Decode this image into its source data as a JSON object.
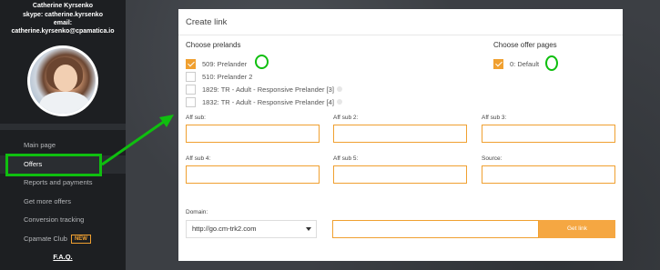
{
  "user": {
    "name": "Catherine Kyrsenko",
    "skype": "skype: catherine.kyrsenko",
    "email_label": "email:",
    "email": "catherine.kyrsenko@cpamatica.io"
  },
  "sidebar": {
    "items": [
      {
        "label": "Main page"
      },
      {
        "label": "Offers"
      },
      {
        "label": "Reports and payments"
      },
      {
        "label": "Get more offers"
      },
      {
        "label": "Conversion tracking"
      },
      {
        "label": "Cpamate Club",
        "badge": "NEW"
      }
    ],
    "faq": "F.A.Q."
  },
  "panel": {
    "title": "Create link",
    "prelands_title": "Choose prelands",
    "prelands": [
      {
        "label": "509: Prelander",
        "checked": true
      },
      {
        "label": "510: Prelander 2",
        "checked": false
      },
      {
        "label": "1829: TR - Adult - Responsive Prelander [3]",
        "checked": false
      },
      {
        "label": "1832: TR - Adult - Responsive Prelander [4]",
        "checked": false
      }
    ],
    "offer_pages_title": "Choose offer pages",
    "offer_pages": [
      {
        "label": "0: Default",
        "checked": true
      }
    ],
    "fields": {
      "aff_sub": "Aff sub:",
      "aff_sub2": "Aff sub 2:",
      "aff_sub3": "Aff sub 3:",
      "aff_sub4": "Aff sub 4:",
      "aff_sub5": "Aff sub 5:",
      "source": "Source:"
    },
    "domain_label": "Domain:",
    "domain_value": "http://go.cm-trk2.com",
    "get_link_label": "Get link"
  },
  "colors": {
    "accent": "#f0a030",
    "annotation": "#0fbf0f",
    "sidebar_bg": "#1d1f22"
  }
}
